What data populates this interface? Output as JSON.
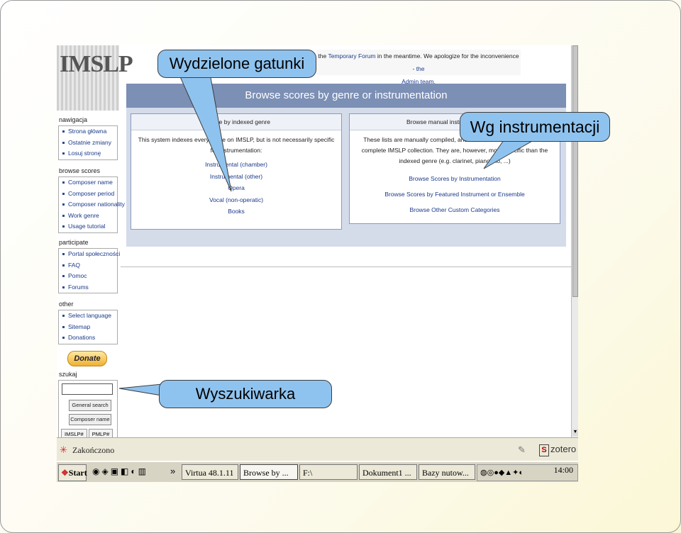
{
  "browser": {
    "logo_text": "IMSLP",
    "notice": {
      "line1_prefix": "the",
      "line1_link": "Temporary Forum",
      "line1_mid": "in the meantime. We apologize for the inconvenience -",
      "line1_link2": "the",
      "line2_link": "Admin team."
    },
    "nav": {
      "sections": [
        {
          "heading": "nawigacja",
          "items": [
            "Strona główna",
            "Ostatnie zmiany",
            "Losuj stronę"
          ]
        },
        {
          "heading": "browse scores",
          "items": [
            "Composer name",
            "Composer period",
            "Composer nationality",
            "Work genre",
            "Usage tutorial"
          ]
        },
        {
          "heading": "participate",
          "items": [
            "Portal społeczności",
            "FAQ",
            "Pomoc",
            "Forums"
          ]
        },
        {
          "heading": "other",
          "items": [
            "Select language",
            "Sitemap",
            "Donations"
          ]
        }
      ],
      "donate_label": "Donate",
      "search_heading": "szukaj",
      "general_search": "General search",
      "composer_name": "Composer name",
      "tabs": [
        "IMSLP#",
        "PMLP#"
      ]
    },
    "main": {
      "title": "Browse scores by genre or instrumentation",
      "left_box": {
        "title": "Browse by indexed genre",
        "description": "This system indexes every score on IMSLP, but is not necessarily specific for instrumentation:",
        "links": [
          "Instrumental (chamber)",
          "Instrumental (other)",
          "Opera",
          "Vocal (non-operatic)",
          "Books"
        ]
      },
      "right_box": {
        "title": "Browse manual instrumentation lists",
        "description": "These lists are manually compiled, and do not necessarily reflect the complete IMSLP collection. They are, however, more specific than the indexed genre (e.g. clarinet, piano trio, ...)",
        "links": [
          "Browse Scores by Instrumentation",
          "Browse Scores by Featured Instrument or Ensemble",
          "Browse Other Custom Categories"
        ]
      }
    },
    "status": {
      "text": "Zakończono",
      "zotero": "zotero"
    },
    "taskbar": {
      "start": "Start",
      "chevron": "»",
      "buttons": [
        "Virtua 48.1.11",
        "Browse by ...",
        "F:\\",
        "Dokument1 ...",
        "Bazy nutow..."
      ],
      "clock": "14:00"
    }
  },
  "callouts": {
    "genres": "Wydzielone gatunki",
    "instrumentation": "Wg instrumentacji",
    "search": "Wyszukiwarka"
  },
  "colors": {
    "callout": "#8fc3ef",
    "header": "#7c8fb5",
    "panel": "#d4dcea",
    "link": "#1a3a8a"
  }
}
